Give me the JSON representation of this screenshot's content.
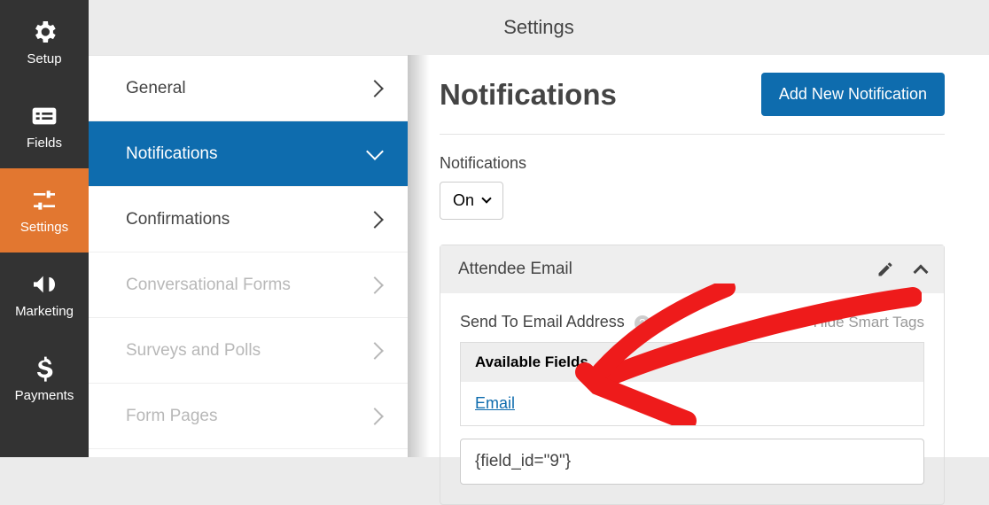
{
  "topbar": {
    "title": "Settings"
  },
  "rail": {
    "setup": "Setup",
    "fields": "Fields",
    "settings": "Settings",
    "marketing": "Marketing",
    "payments": "Payments"
  },
  "sub": {
    "general": "General",
    "notifications": "Notifications",
    "confirmations": "Confirmations",
    "conversational": "Conversational Forms",
    "surveys": "Surveys and Polls",
    "pages": "Form Pages"
  },
  "main": {
    "heading": "Notifications",
    "add_btn": "Add New Notification",
    "toggle_label": "Notifications",
    "toggle_value": "On",
    "panel_title": "Attendee Email",
    "send_to": "Send To Email Address",
    "hide_tags": "Hide Smart Tags",
    "available_fields": "Available Fields",
    "field_link": "Email",
    "input_value": "{field_id=\"9\"}"
  }
}
